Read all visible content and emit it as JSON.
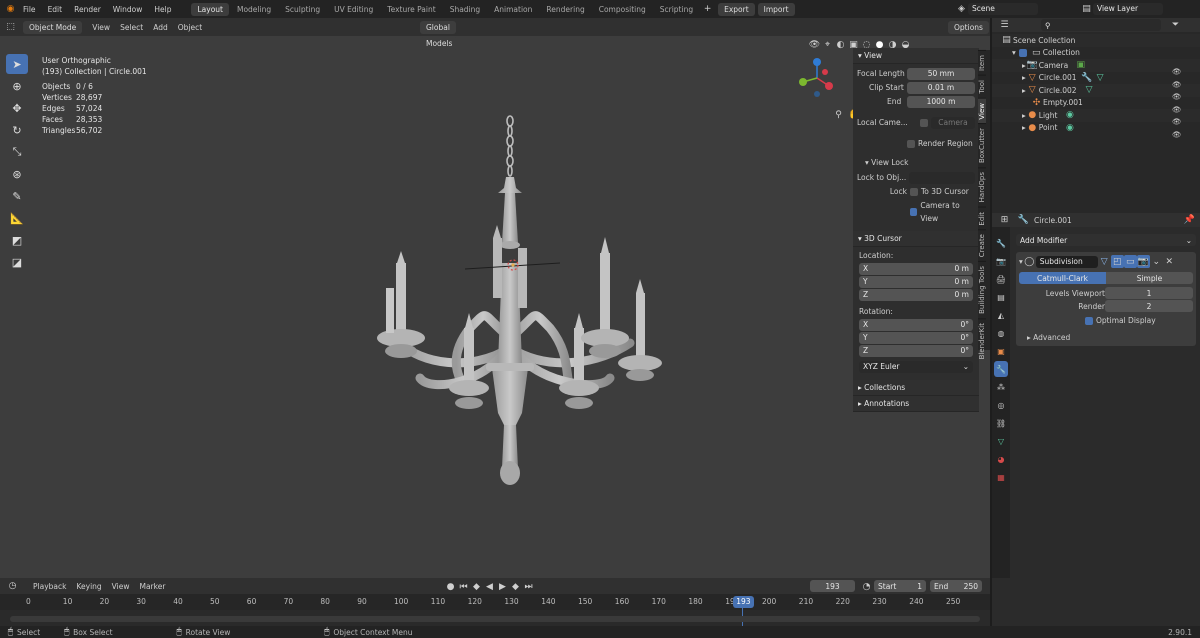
{
  "menu": [
    "File",
    "Edit",
    "Render",
    "Window",
    "Help"
  ],
  "workspaces": [
    "Layout",
    "Modeling",
    "Sculpting",
    "UV Editing",
    "Texture Paint",
    "Shading",
    "Animation",
    "Rendering",
    "Compositing",
    "Scripting"
  ],
  "export_label": "Export",
  "import_label": "Import",
  "scene_name": "Scene",
  "view_layer": "View Layer",
  "viewport": {
    "mode": "Object Mode",
    "menus": [
      "View",
      "Select",
      "Add",
      "Object"
    ],
    "transform_orientation": "Global",
    "snap_target": "Models",
    "options_label": "Options",
    "view_name": "User Orthographic",
    "collection_line": "(193) Collection | Circle.001",
    "stats": [
      {
        "k": "Objects",
        "v": "0 / 6"
      },
      {
        "k": "Vertices",
        "v": "28,697"
      },
      {
        "k": "Edges",
        "v": "57,024"
      },
      {
        "k": "Faces",
        "v": "28,353"
      },
      {
        "k": "Triangles",
        "v": "56,702"
      }
    ]
  },
  "npanel": {
    "view_title": "View",
    "focal_length_label": "Focal Length",
    "focal_length": "50 mm",
    "clip_start_label": "Clip Start",
    "clip_start": "0.01 m",
    "end_label": "End",
    "end": "1000 m",
    "local_camera_label": "Local Came...",
    "local_camera_value": "Camera",
    "render_region": "Render Region",
    "view_lock_title": "View Lock",
    "lock_to_object_label": "Lock to Obj...",
    "lock_label": "Lock",
    "to_3d_cursor": "To 3D Cursor",
    "camera_to_view": "Camera to View",
    "cursor_title": "3D Cursor",
    "location_label": "Location:",
    "loc": [
      {
        "axis": "X",
        "v": "0 m"
      },
      {
        "axis": "Y",
        "v": "0 m"
      },
      {
        "axis": "Z",
        "v": "0 m"
      }
    ],
    "rotation_label": "Rotation:",
    "rot": [
      {
        "axis": "X",
        "v": "0°"
      },
      {
        "axis": "Y",
        "v": "0°"
      },
      {
        "axis": "Z",
        "v": "0°"
      }
    ],
    "rotation_mode": "XYZ Euler",
    "collections": "Collections",
    "annotations": "Annotations",
    "tabs": [
      "Item",
      "Tool",
      "View",
      "BoxCutter",
      "HardOps",
      "Edit",
      "Create",
      "Building Tools",
      "BlenderKit"
    ]
  },
  "outliner": {
    "root": "Scene Collection",
    "items": [
      {
        "name": "Collection",
        "color": "#bbbbbb",
        "depth": 1,
        "icon": "collection-icon"
      },
      {
        "name": "Camera",
        "color": "#d8d8d8",
        "depth": 2,
        "icon": "camera-icon"
      },
      {
        "name": "Circle.001",
        "color": "#d8d8d8",
        "depth": 2,
        "icon": "mesh-icon"
      },
      {
        "name": "Circle.002",
        "color": "#d8d8d8",
        "depth": 2,
        "icon": "mesh-icon"
      },
      {
        "name": "Empty.001",
        "color": "#d8d8d8",
        "depth": 2,
        "icon": "empty-icon"
      },
      {
        "name": "Light",
        "color": "#d8d8d8",
        "depth": 2,
        "icon": "light-icon"
      },
      {
        "name": "Point",
        "color": "#d8d8d8",
        "depth": 2,
        "icon": "light-icon"
      }
    ]
  },
  "properties": {
    "object_name": "Circle.001",
    "add_modifier": "Add Modifier",
    "modifier_name": "Subdivision",
    "catmull_clark": "Catmull-Clark",
    "simple": "Simple",
    "levels_viewport_label": "Levels Viewport",
    "levels_viewport": "1",
    "render_label": "Render",
    "render_value": "2",
    "optimal_display": "Optimal Display",
    "advanced": "Advanced"
  },
  "timeline": {
    "menus": [
      "Playback",
      "Keying",
      "View",
      "Marker"
    ],
    "current_frame": "193",
    "start_label": "Start",
    "start": "1",
    "end_label": "End",
    "end": "250",
    "ticks": [
      "0",
      "10",
      "20",
      "30",
      "40",
      "50",
      "60",
      "70",
      "80",
      "90",
      "100",
      "110",
      "120",
      "130",
      "140",
      "150",
      "160",
      "170",
      "180",
      "190",
      "200",
      "210",
      "220",
      "230",
      "240",
      "250"
    ],
    "playhead": "193"
  },
  "status": {
    "select": "Select",
    "box_select": "Box Select",
    "rotate_view": "Rotate View",
    "context_menu": "Object Context Menu",
    "version": "2.90.1"
  }
}
